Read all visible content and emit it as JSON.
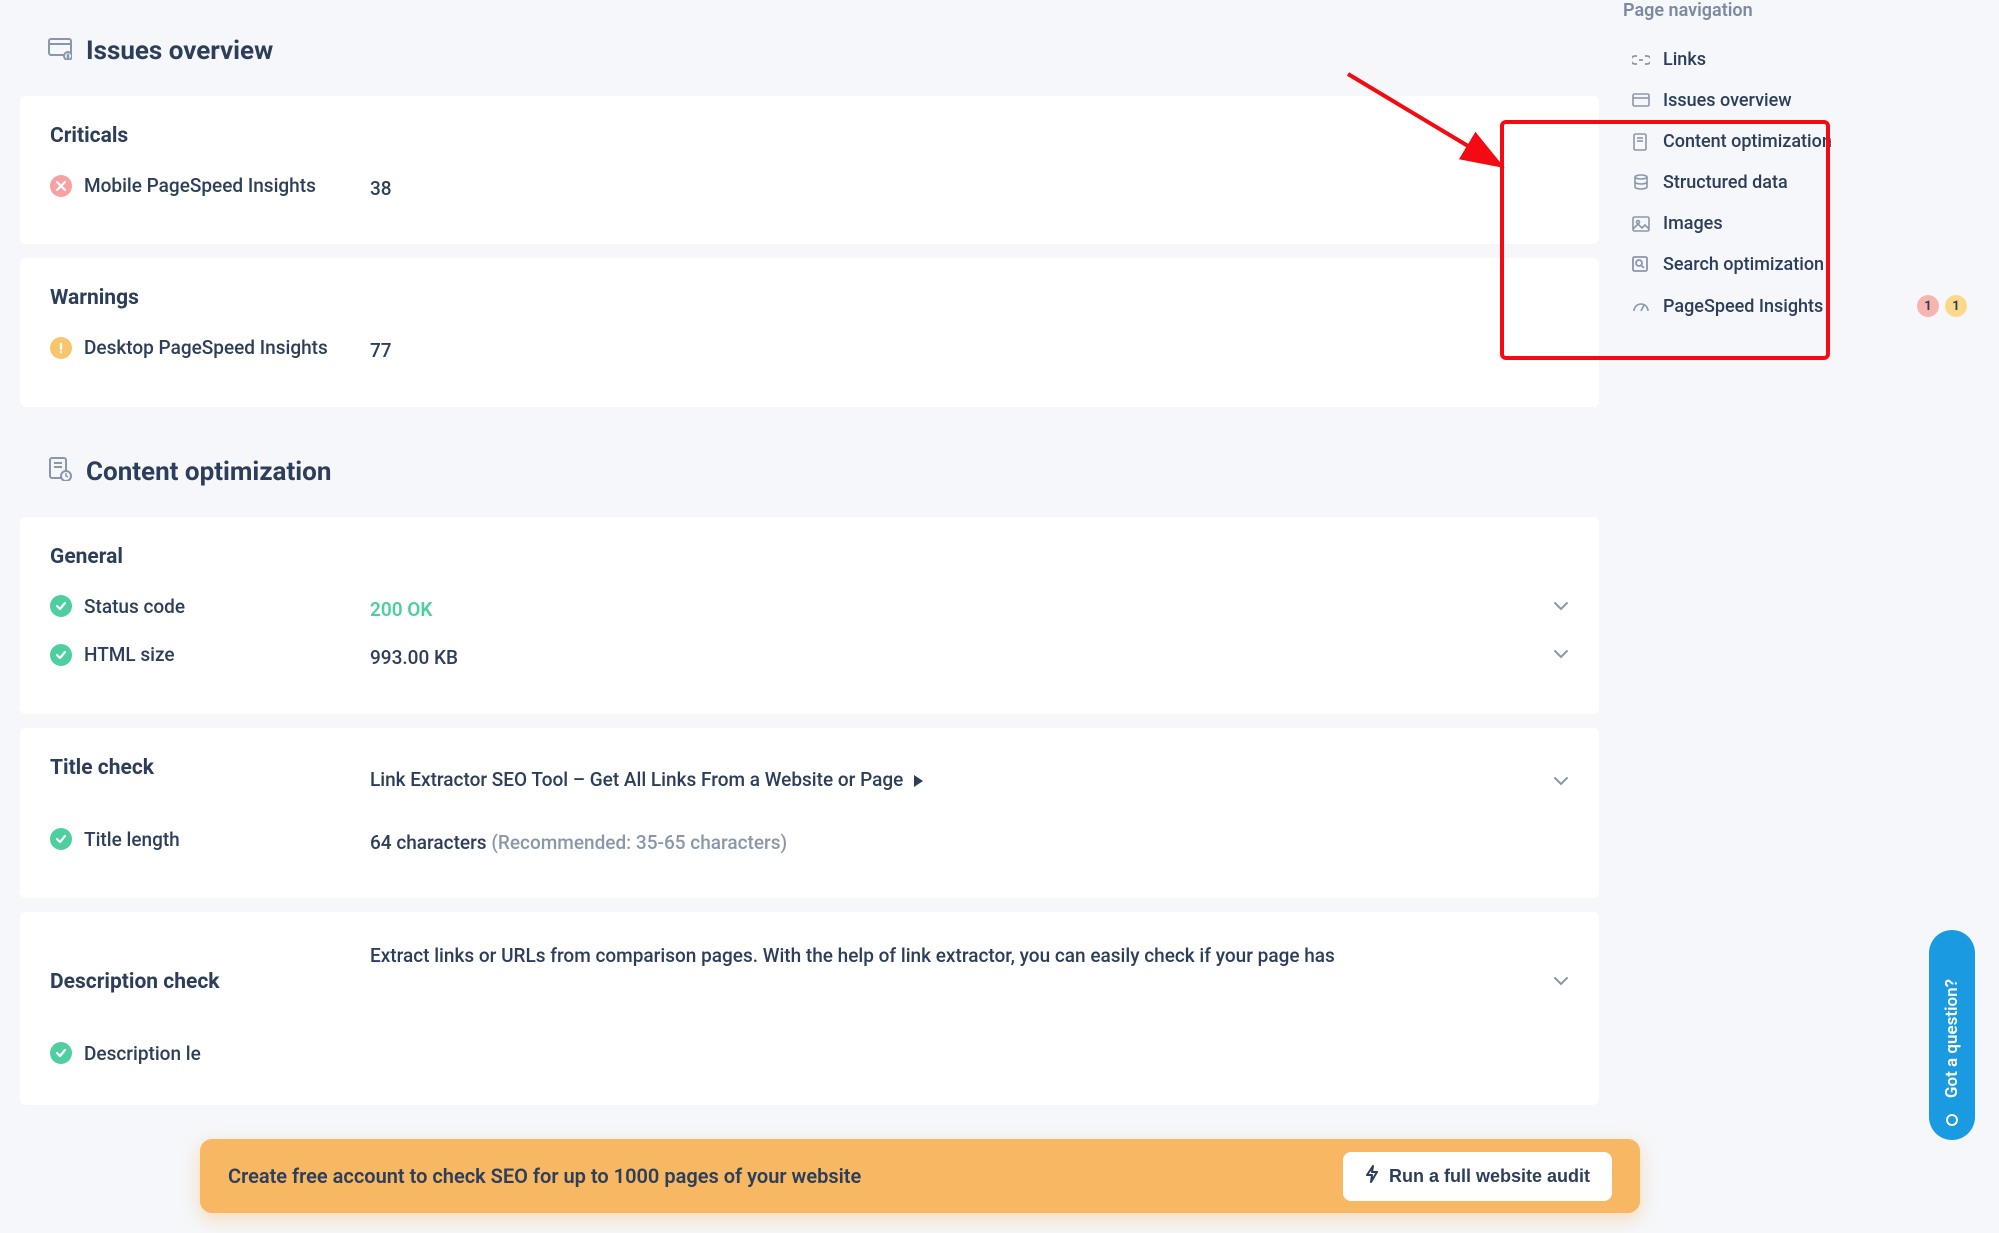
{
  "sections": {
    "issues_title": "Issues overview",
    "content_title": "Content optimization"
  },
  "criticals": {
    "heading": "Criticals",
    "item_label": "Mobile PageSpeed Insights",
    "item_value": "38"
  },
  "warnings": {
    "heading": "Warnings",
    "item_label": "Desktop PageSpeed Insights",
    "item_value": "77"
  },
  "general": {
    "heading": "General",
    "status_label": "Status code",
    "status_value": "200 OK",
    "html_label": "HTML size",
    "html_value": "993.00 KB"
  },
  "title_check": {
    "heading": "Title check",
    "title_text": "Link Extractor SEO Tool – Get All Links From a Website or Page",
    "length_label": "Title length",
    "length_value": "64 characters",
    "length_rec": "(Recommended: 35-65 characters)"
  },
  "desc_check": {
    "heading": "Description check",
    "text": "Extract links or URLs from comparison pages. With the help of link extractor, you can easily check if your page has",
    "length_label": "Description le"
  },
  "nav": {
    "title": "Page navigation",
    "items": [
      "Links",
      "Issues overview",
      "Content optimization",
      "Structured data",
      "Images",
      "Search optimization",
      "PageSpeed Insights"
    ],
    "badge_red": "1",
    "badge_orange": "1"
  },
  "banner": {
    "text": "Create free account to check SEO for up to 1000 pages of your website",
    "button": "Run a full website audit"
  },
  "question_tab": "Got a question?"
}
